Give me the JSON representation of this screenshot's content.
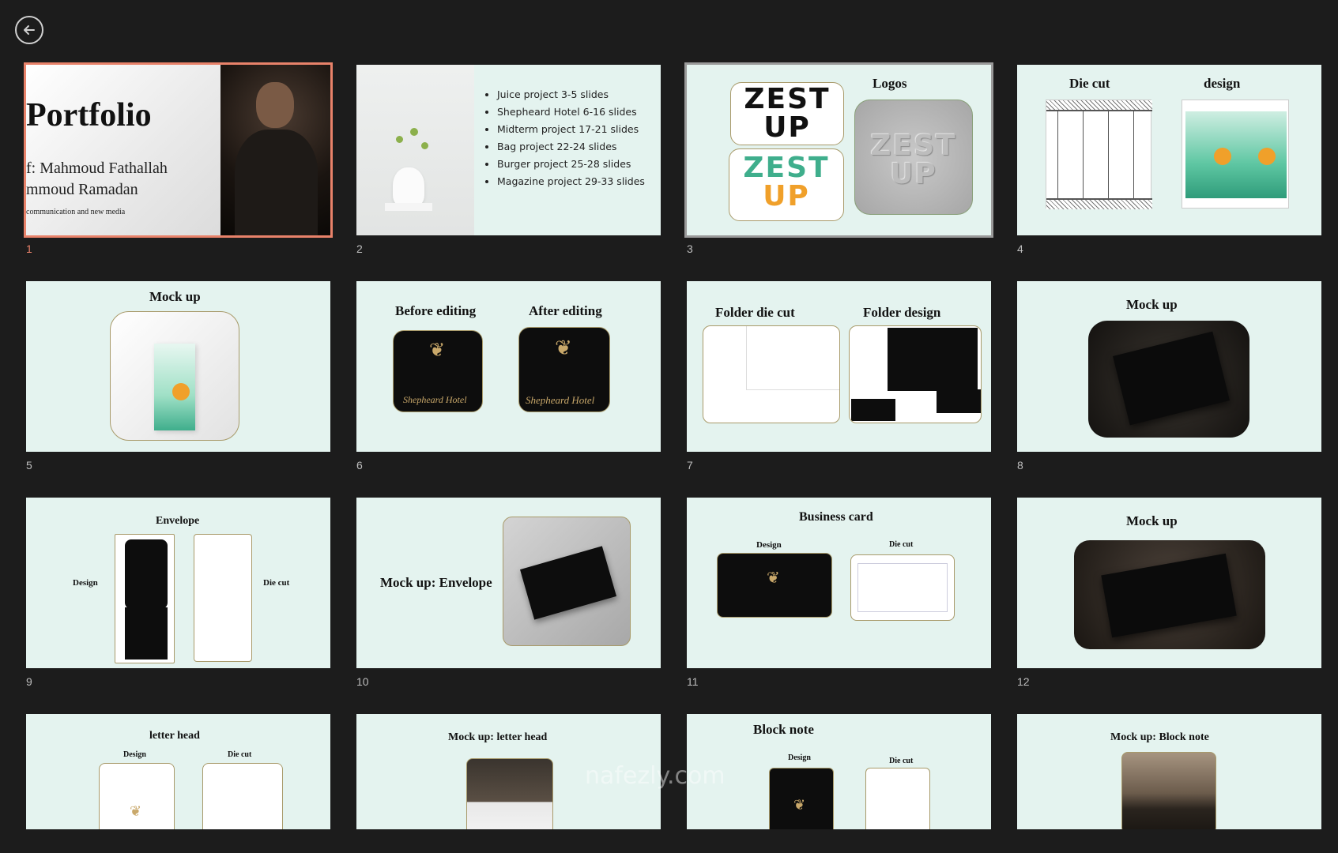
{
  "slides": [
    {
      "num": "1",
      "title": "Portfolio",
      "line1": "f: Mahmoud Fathallah",
      "line2": "mmoud Ramadan",
      "line3": "communication and new media"
    },
    {
      "num": "2",
      "bullets": [
        "Juice project 3-5 slides",
        "Shepheard Hotel 6-16 slides",
        "Midterm project 17-21 slides",
        "Bag project 22-24 slides",
        "Burger project 25-28 slides",
        "Magazine project 29-33 slides"
      ]
    },
    {
      "num": "3",
      "title": "Logos",
      "logo_line1": "ZEST",
      "logo_line2": "UP"
    },
    {
      "num": "4",
      "left_title": "Die cut",
      "right_title": "design"
    },
    {
      "num": "5",
      "title": "Mock up"
    },
    {
      "num": "6",
      "left_title": "Before editing",
      "right_title": "After editing",
      "brand": "Shepheard Hotel"
    },
    {
      "num": "7",
      "left_title": "Folder die cut",
      "right_title": "Folder design"
    },
    {
      "num": "8",
      "title": "Mock up"
    },
    {
      "num": "9",
      "title": "Envelope",
      "left_label": "Design",
      "right_label": "Die cut"
    },
    {
      "num": "10",
      "title": "Mock up: Envelope"
    },
    {
      "num": "11",
      "title": "Business card",
      "left_label": "Design",
      "right_label": "Die cut"
    },
    {
      "num": "12",
      "title": "Mock up"
    },
    {
      "num": "13",
      "title": "letter head",
      "left_label": "Design",
      "right_label": "Die cut"
    },
    {
      "num": "14",
      "title": "Mock up: letter head"
    },
    {
      "num": "15",
      "title": "Block note",
      "left_label": "Design",
      "right_label": "Die cut"
    },
    {
      "num": "16",
      "title": "Mock up: Block note"
    }
  ],
  "watermark": "nafezly.com",
  "colors": {
    "slide_bg": "#e4f3ef",
    "selected": "#e8826a",
    "gold": "#c9a86a",
    "teal": "#3fae8c",
    "orange": "#f0a02a"
  }
}
